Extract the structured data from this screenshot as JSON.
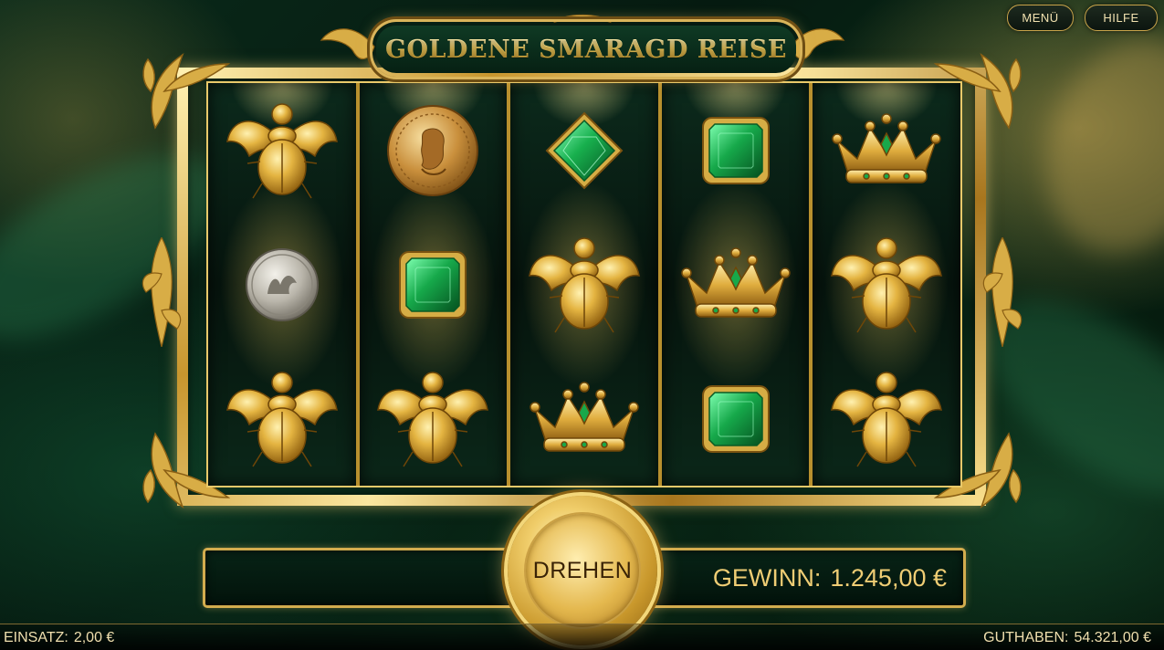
{
  "game": {
    "title": "GOLDENE SMARAGD REISE"
  },
  "top_buttons": {
    "menu_label": "MENÜ",
    "help_label": "HILFE"
  },
  "reels": [
    [
      "golden-scarab",
      "silver-coin",
      "golden-scarab"
    ],
    [
      "gold-coin",
      "emerald-square",
      "golden-scarab"
    ],
    [
      "emerald-octagon",
      "golden-scarab",
      "golden-crown"
    ],
    [
      "emerald-square",
      "golden-crown",
      "emerald-square"
    ],
    [
      "golden-crown",
      "golden-scarab",
      "golden-scarab"
    ]
  ],
  "spin": {
    "label": "DREHEN"
  },
  "win": {
    "label": "GEWINN:",
    "value": "1.245,00 €"
  },
  "footer": {
    "bet_label": "EINSATZ:",
    "bet_value": "2,00 €",
    "balance_label": "GUTHABEN:",
    "balance_value": "54.321,00 €"
  },
  "colors": {
    "gold": "#d9b45a",
    "emerald": "#19a84a",
    "background": "#06170e"
  }
}
